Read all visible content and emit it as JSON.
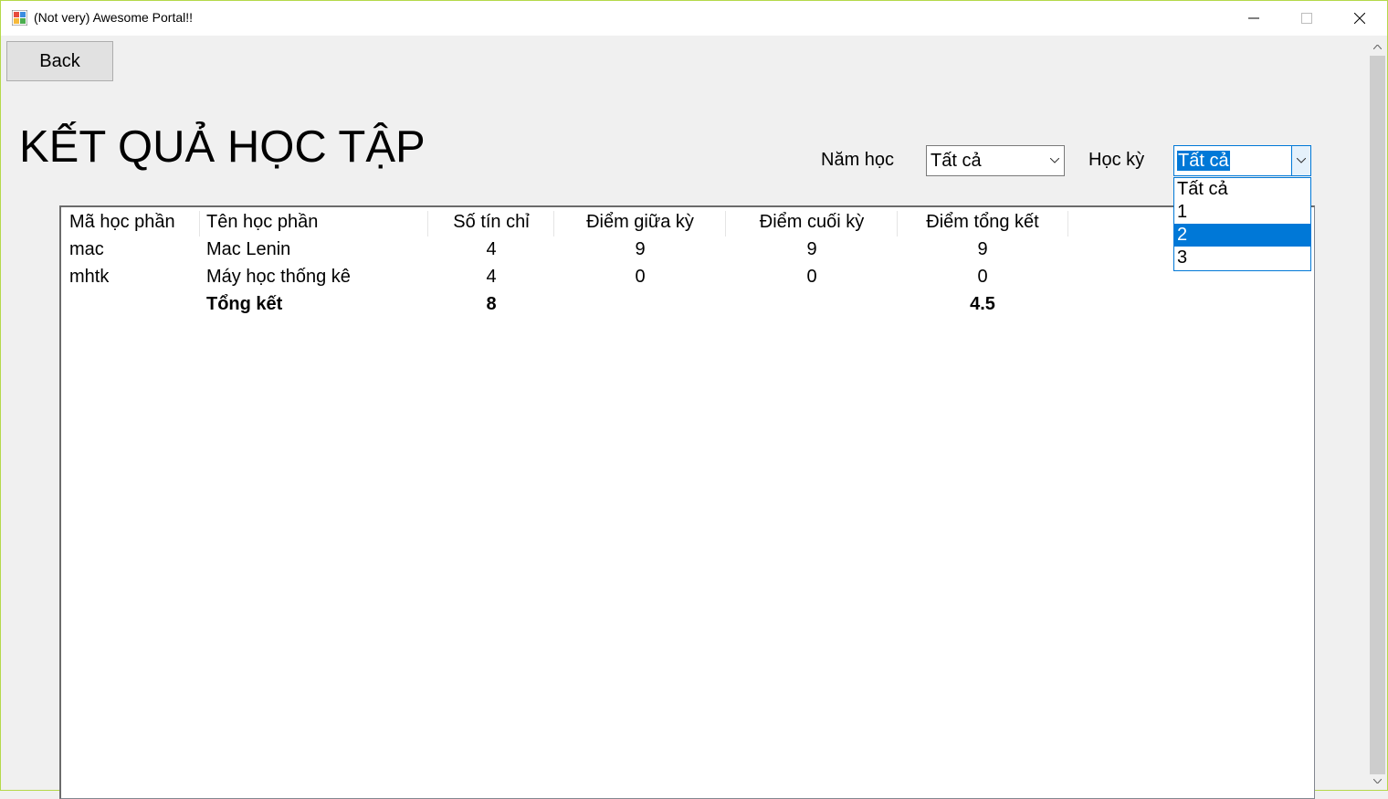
{
  "window": {
    "title": "(Not very) Awesome Portal!!",
    "accent_border": "#b5d94a"
  },
  "toolbar": {
    "back_label": "Back"
  },
  "page": {
    "title": "KẾT QUẢ HỌC TẬP"
  },
  "filters": {
    "year_label": "Năm học",
    "year_value": "Tất cả",
    "semester_label": "Học kỳ",
    "semester_value": "Tất cả",
    "semester_options": [
      "Tất cả",
      "1",
      "2",
      "3"
    ],
    "semester_highlighted": "2"
  },
  "grid": {
    "headers": [
      "Mã học phần",
      "Tên học phần",
      "Số tín chỉ",
      "Điểm giữa kỳ",
      "Điểm cuối kỳ",
      "Điểm tổng kết"
    ],
    "rows": [
      {
        "code": "mac",
        "name": "Mac Lenin",
        "credits": "4",
        "midterm": "9",
        "final": "9",
        "total": "9"
      },
      {
        "code": "mhtk",
        "name": "Máy học thống kê",
        "credits": "4",
        "midterm": "0",
        "final": "0",
        "total": "0"
      }
    ],
    "summary": {
      "label": "Tổng kết",
      "credits": "8",
      "total": "4.5"
    }
  },
  "colors": {
    "selection": "#0078d7",
    "background": "#f0f0f0"
  }
}
